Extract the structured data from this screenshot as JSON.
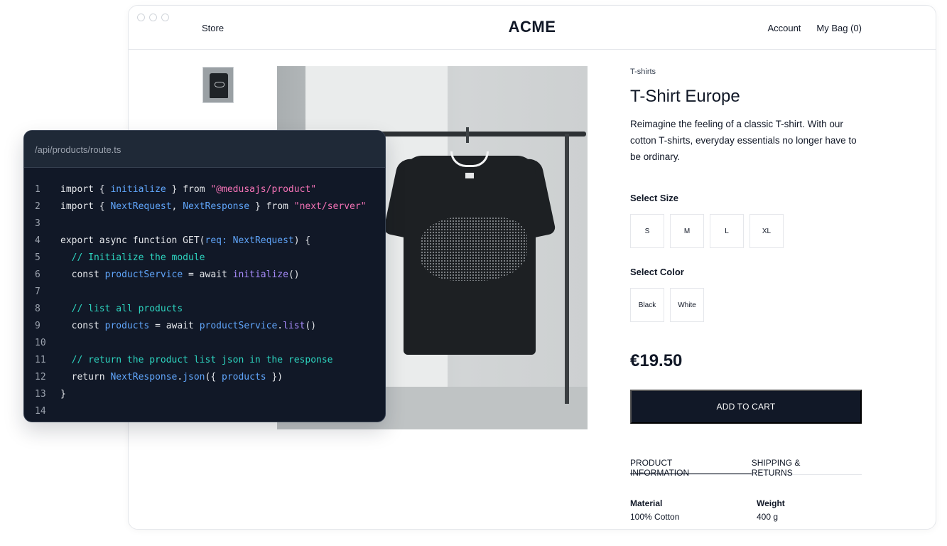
{
  "nav": {
    "store": "Store",
    "logo": "ACME",
    "account": "Account",
    "bag": "My Bag (0)"
  },
  "product": {
    "category": "T-shirts",
    "title": "T-Shirt Europe",
    "description": "Reimagine the feeling of a classic T-shirt. With our cotton T-shirts, everyday essentials no longer have to be ordinary.",
    "size_label": "Select Size",
    "sizes": [
      "S",
      "M",
      "L",
      "XL"
    ],
    "color_label": "Select Color",
    "colors": [
      "Black",
      "White"
    ],
    "price": "€19.50",
    "add_to_cart": "ADD TO CART",
    "tabs": [
      "PRODUCT INFORMATION",
      "SHIPPING & RETURNS"
    ],
    "attributes": [
      {
        "label": "Material",
        "value": "100% Cotton"
      },
      {
        "label": "Weight",
        "value": "400 g"
      }
    ]
  },
  "code": {
    "path": "/api/products/route.ts",
    "line_numbers": [
      "1",
      "2",
      "3",
      "4",
      "5",
      "6",
      "7",
      "8",
      "9",
      "10",
      "11",
      "12",
      "13",
      "14"
    ],
    "lines": [
      "import { initialize } from \"@medusajs/product\"",
      "import { NextRequest, NextResponse } from \"next/server\"",
      "",
      "export async function GET(req: NextRequest) {",
      "  // Initialize the module",
      "  const productService = await initialize()",
      "",
      "  // list all products",
      "  const products = await productService.list()",
      "",
      "  // return the product list json in the response",
      "  return NextResponse.json({ products })",
      "}",
      ""
    ]
  },
  "colors": {
    "primary": "#111827",
    "code_bg": "#111827",
    "code_blue": "#60a5fa",
    "code_pink": "#f472b6",
    "code_teal": "#2dd4bf",
    "code_purple": "#a78bfa"
  }
}
